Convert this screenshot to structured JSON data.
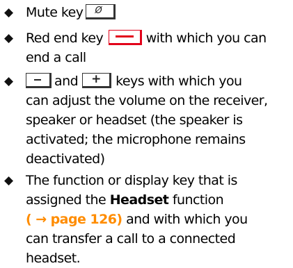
{
  "bullet_symbol": "◆",
  "items": [
    {
      "text_before": "Mute key"
    },
    {
      "text_before": "Red end key",
      "text_after": "with which you can",
      "line2": "end a call"
    },
    {
      "and_text": "and",
      "line1_after": "keys with which you",
      "line2": "can adjust the volume on the receiver,",
      "line3": "speaker or headset (the speaker is",
      "line4": "activated; the microphone remains",
      "line5": "deactivated)"
    },
    {
      "line1": "The function or display key that is",
      "line2_before": "assigned the",
      "line2_bold": "Headset",
      "line2_after": "function",
      "line3_link": "( → page 126)",
      "line3_after": "and with which you",
      "line4": "can transfer a call to a connected",
      "line5": "headset."
    }
  ],
  "keys": {
    "mute_icon": "mute-key-icon",
    "end_icon": "end-key-icon",
    "minus_icon": "volume-minus-key-icon",
    "plus_icon": "volume-plus-key-icon",
    "mute_glyph": "Ø",
    "plus_glyph": "+"
  },
  "colors": {
    "end_key": "#e2001a",
    "page_reference": "#ff8c00"
  }
}
